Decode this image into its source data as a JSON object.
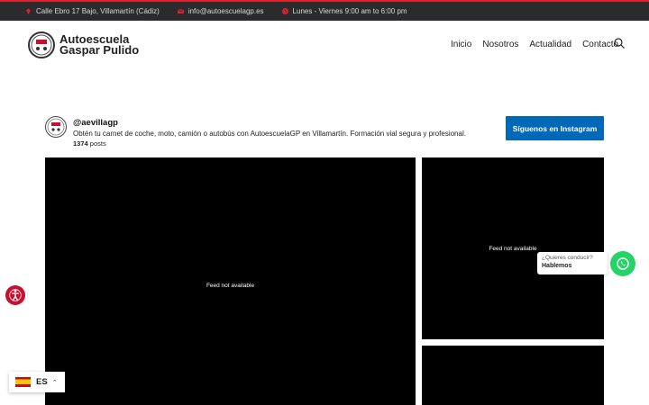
{
  "topbar": {
    "address": "Calle Ebro 17 Bajo, Villamartín (Cádiz)",
    "email": "info@autoescuelagp.es",
    "hours": "Lunes - Viernes 9:00 am to 6:00 pm"
  },
  "logo": {
    "line1": "Autoescuela",
    "line2": "Gaspar Pulido"
  },
  "nav": {
    "items": [
      "Inicio",
      "Nosotros",
      "Actualidad",
      "Contacto"
    ]
  },
  "instagram": {
    "username": "@aevillagp",
    "bio": "Obtén tu carnet de coche, moto, camión o autobús con AutoescuelaGP en Villamartín. Formación vial segura y profesional.",
    "posts_count": "1374",
    "posts_label": "posts",
    "follow_label": "Síguenos en Instagram",
    "feed_unavailable": "Feed not available"
  },
  "whatsapp": {
    "question": "¿Quieres conducir?",
    "cta": "Hablemos"
  },
  "language": {
    "code": "ES"
  },
  "colors": {
    "accent": "#d9232d",
    "follow": "#0068b8",
    "whatsapp": "#25d366",
    "accessibility": "#c8102e"
  }
}
